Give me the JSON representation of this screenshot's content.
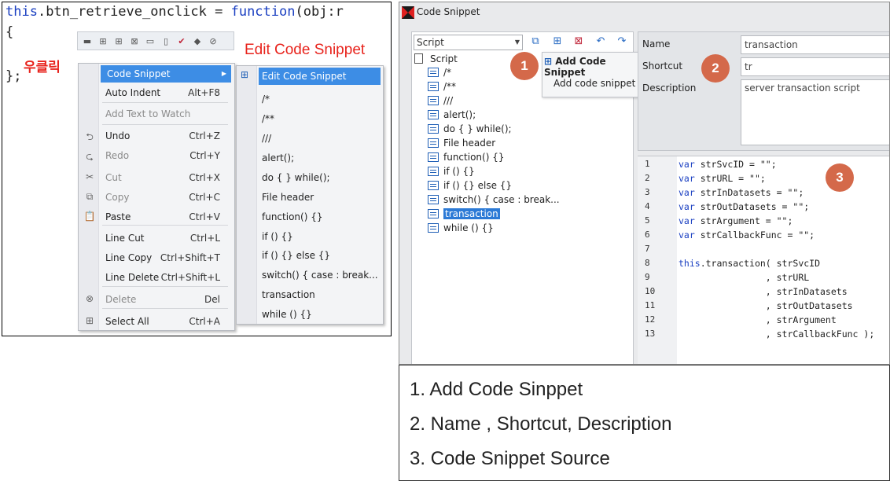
{
  "left_panel": {
    "code_lines": [
      "this.btn_retrieve_onclick = function(obj:r",
      "{",
      "};"
    ],
    "right_click_label": "우클릭",
    "edit_label": "Edit Code Snippet",
    "context_menu": [
      {
        "label": "Code Snippet",
        "shortcut": "",
        "icon": "",
        "highlight": true,
        "submenu": true
      },
      {
        "label": "Auto Indent",
        "shortcut": "Alt+F8",
        "icon": ""
      },
      {
        "label": "Add Text to Watch",
        "shortcut": "",
        "icon": "",
        "disabled": true
      },
      {
        "label": "Undo",
        "shortcut": "Ctrl+Z",
        "icon": "undo-icon"
      },
      {
        "label": "Redo",
        "shortcut": "Ctrl+Y",
        "icon": "redo-icon",
        "disabled": true
      },
      {
        "label": "Cut",
        "shortcut": "Ctrl+X",
        "icon": "cut-icon",
        "disabled": true
      },
      {
        "label": "Copy",
        "shortcut": "Ctrl+C",
        "icon": "copy-icon",
        "disabled": true
      },
      {
        "label": "Paste",
        "shortcut": "Ctrl+V",
        "icon": "paste-icon"
      },
      {
        "label": "Line Cut",
        "shortcut": "Ctrl+L",
        "icon": ""
      },
      {
        "label": "Line Copy",
        "shortcut": "Ctrl+Shift+T",
        "icon": ""
      },
      {
        "label": "Line Delete",
        "shortcut": "Ctrl+Shift+L",
        "icon": ""
      },
      {
        "label": "Delete",
        "shortcut": "Del",
        "icon": "delete-icon",
        "disabled": true
      },
      {
        "label": "Select All",
        "shortcut": "Ctrl+A",
        "icon": "select-all-icon"
      }
    ],
    "submenu": [
      "Edit Code Snippet",
      "/*",
      "/**",
      "///",
      "alert();",
      "do { } while();",
      "File header",
      "function() {}",
      "if () {}",
      "if () {} else {}",
      "switch() { case : break...",
      "transaction",
      "while () {}"
    ]
  },
  "window": {
    "title": "Code Snippet",
    "script_select": "Script",
    "tree_root": "Script",
    "tree_items": [
      "/*",
      "/**",
      "///",
      "alert();",
      "do { } while();",
      "File header",
      "function() {}",
      "if () {}",
      "if () {} else {}",
      "switch() { case : break...",
      "transaction",
      "while () {}"
    ],
    "selected_item": "transaction",
    "popup_items": [
      "Add Code Snippet",
      "Add code snippet"
    ],
    "fields": {
      "name_label": "Name",
      "name_value": "transaction",
      "shortcut_label": "Shortcut",
      "shortcut_value": "tr",
      "description_label": "Description",
      "description_value": "server transaction  script"
    },
    "code": [
      {
        "n": "1",
        "t": "var strSvcID = \"\";"
      },
      {
        "n": "2",
        "t": "var strURL = \"\";"
      },
      {
        "n": "3",
        "t": "var strInDatasets = \"\";"
      },
      {
        "n": "4",
        "t": "var strOutDatasets = \"\";"
      },
      {
        "n": "5",
        "t": "var strArgument = \"\";"
      },
      {
        "n": "6",
        "t": "var strCallbackFunc = \"\";"
      },
      {
        "n": "7",
        "t": ""
      },
      {
        "n": "8",
        "t": "this.transaction( strSvcID"
      },
      {
        "n": "9",
        "t": "                , strURL"
      },
      {
        "n": "10",
        "t": "                , strInDatasets"
      },
      {
        "n": "11",
        "t": "                , strOutDatasets"
      },
      {
        "n": "12",
        "t": "                , strArgument"
      },
      {
        "n": "13",
        "t": "                , strCallbackFunc );"
      }
    ],
    "badges": [
      "1",
      "2",
      "3"
    ]
  },
  "notes": [
    "1.  Add Code Sinppet",
    "2.  Name , Shortcut, Description",
    "3.  Code Snippet Source"
  ],
  "colors": {
    "accent": "#3d8de5",
    "badge": "#d4694a",
    "annotation": "#e8231c",
    "keyword": "#1a3fc1"
  }
}
